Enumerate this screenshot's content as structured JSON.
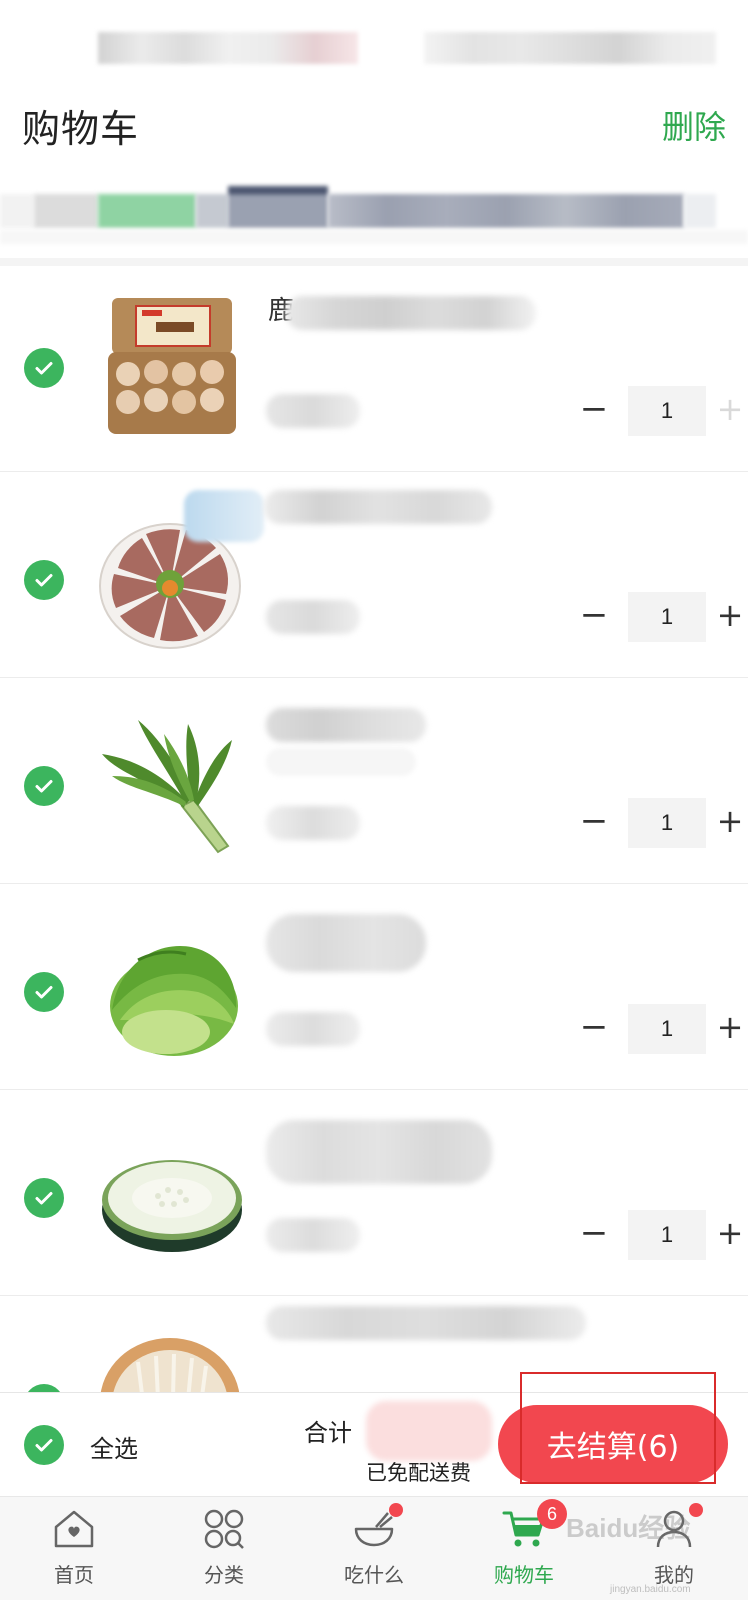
{
  "header": {
    "title": "购物车",
    "delete_label": "删除"
  },
  "items": [
    {
      "name_visible_char": "鹿",
      "quantity": "1",
      "minus": "−",
      "plus": "+",
      "plus_disabled": true,
      "image": "egg-carton-image"
    },
    {
      "quantity": "1",
      "minus": "−",
      "plus": "+",
      "plus_disabled": false,
      "image": "sliced-liver-image"
    },
    {
      "quantity": "1",
      "minus": "−",
      "plus": "+",
      "plus_disabled": false,
      "image": "stem-lettuce-image"
    },
    {
      "quantity": "1",
      "minus": "−",
      "plus": "+",
      "plus_disabled": false,
      "image": "lettuce-image"
    },
    {
      "quantity": "1",
      "minus": "−",
      "plus": "+",
      "plus_disabled": false,
      "image": "winter-melon-image"
    },
    {
      "image": "enoki-mushroom-image"
    }
  ],
  "checkout": {
    "select_all": "全选",
    "total_label": "合计",
    "free_shipping": "已免配送费",
    "button": "去结算(6)"
  },
  "tabs": [
    {
      "label": "首页",
      "icon": "home-icon",
      "active": false
    },
    {
      "label": "分类",
      "icon": "category-icon",
      "active": false
    },
    {
      "label": "吃什么",
      "icon": "bowl-icon",
      "active": false,
      "dot": true
    },
    {
      "label": "购物车",
      "icon": "cart-icon",
      "active": true,
      "badge": "6"
    },
    {
      "label": "我的",
      "icon": "profile-icon",
      "active": false,
      "dot": true
    }
  ],
  "watermark": {
    "text": "Baidu经验",
    "sub": "jingyan.baidu.com"
  },
  "colors": {
    "accent_green": "#2fa84f",
    "check_green": "#3cb55e",
    "checkout_red": "#f2474f"
  }
}
